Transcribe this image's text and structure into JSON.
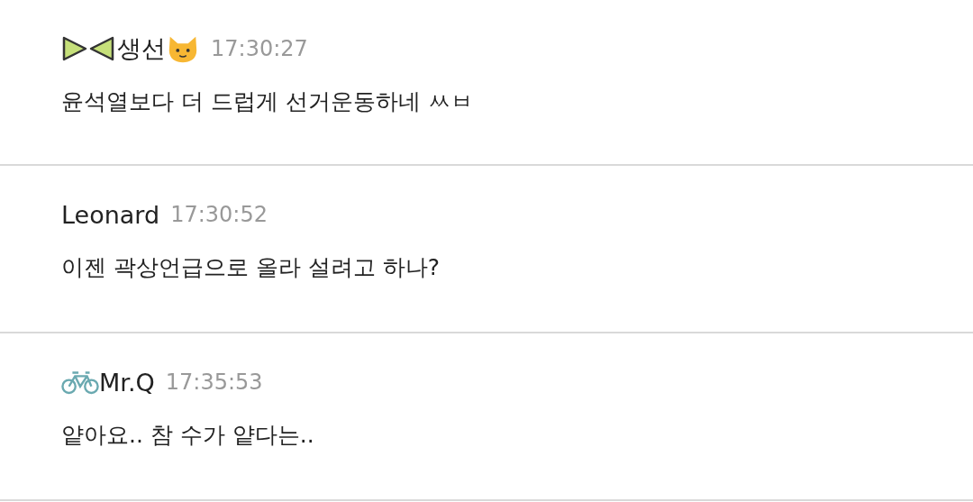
{
  "comments": [
    {
      "icon_before": {
        "kind": "bow"
      },
      "author": "생선",
      "icon_after": {
        "kind": "cat"
      },
      "time": "17:30:27",
      "text": "윤석열보다 더 드럽게 선거운동하네 ㅆㅂ"
    },
    {
      "author": "Leonard",
      "time": "17:30:52",
      "text": "이젠 곽상언급으로 올라 설려고 하나?"
    },
    {
      "icon_before": {
        "kind": "bicycle"
      },
      "author": "Mr.Q",
      "time": "17:35:53",
      "text": "얕아요.. 참 수가 얕다는.."
    }
  ]
}
